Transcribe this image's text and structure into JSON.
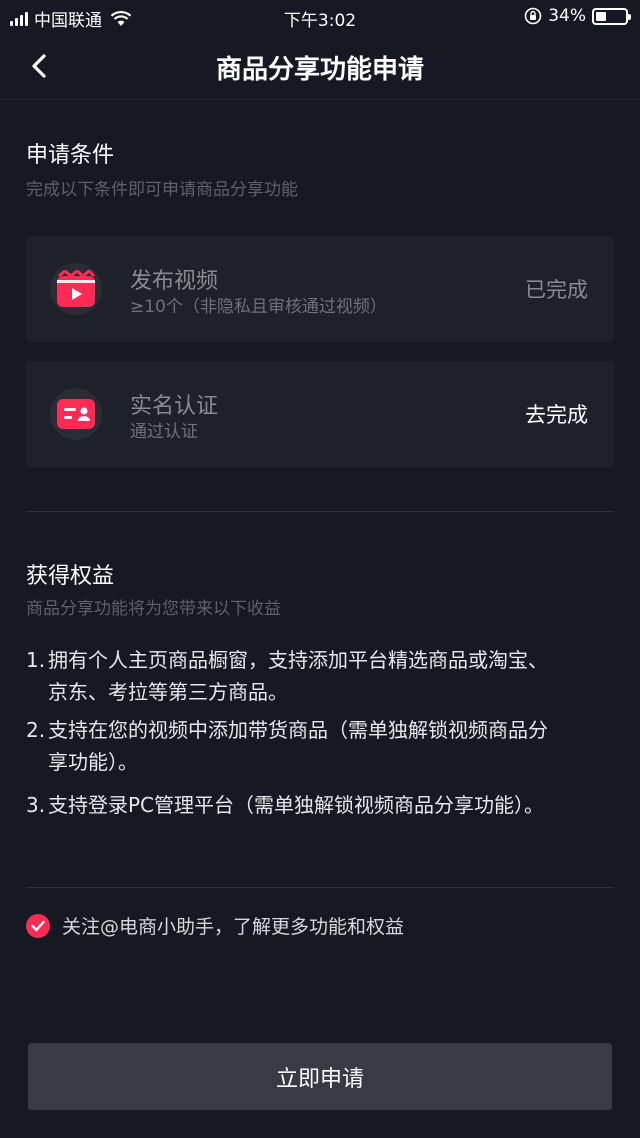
{
  "status_bar": {
    "carrier": "中国联通",
    "time": "下午3:02",
    "battery": "34%",
    "battery_level": 0.34
  },
  "nav": {
    "title": "商品分享功能申请",
    "back_icon": "chevron-left-icon"
  },
  "conditions": {
    "title": "申请条件",
    "subtitle": "完成以下条件即可申请商品分享功能",
    "items": [
      {
        "title": "发布视频",
        "sub": "≥10个（非隐私且审核通过视频）",
        "action": "已完成",
        "icon": "video-clapper-icon",
        "icon_color": "#fe2c55"
      },
      {
        "title": "实名认证",
        "sub": "通过认证",
        "action": "去完成",
        "icon": "id-card-icon",
        "icon_color": "#fe2c55"
      }
    ]
  },
  "benefits": {
    "title": "获得权益",
    "subtitle": "商品分享功能将为您带来以下收益",
    "items": [
      {
        "num": "1.",
        "line1": "拥有个人主页商品橱窗，支持添加平台精选商品或淘宝、",
        "line2": "京东、考拉等第三方商品。"
      },
      {
        "num": "2.",
        "line1": "支持在您的视频中添加带货商品（需单独解锁视频商品分",
        "line2": "享功能）。"
      },
      {
        "num": "3.",
        "line1": "支持登录PC管理平台（需单独解锁视频商品分享功能）。",
        "line2": ""
      }
    ]
  },
  "follow": {
    "checked": true,
    "label": "关注@电商小助手，了解更多功能和权益"
  },
  "apply_button": "立即申请",
  "colors": {
    "background": "#161823",
    "accent": "#fe2c55",
    "card": "#1e202b",
    "button": "#393b44"
  }
}
